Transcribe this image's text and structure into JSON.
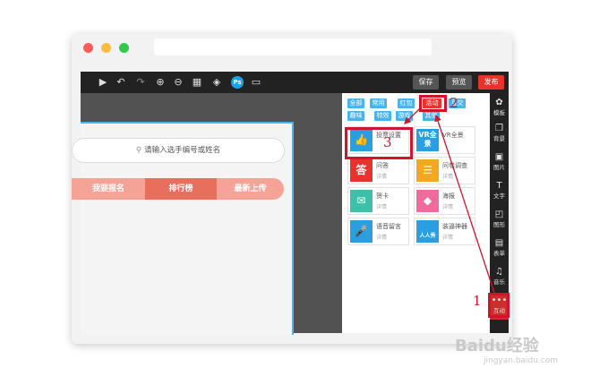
{
  "toolbar": {
    "icons": [
      "play-icon",
      "undo-icon",
      "redo-icon",
      "zoom-in-icon",
      "zoom-out-icon",
      "grid-icon",
      "layers-icon",
      "ps-icon",
      "device-icon"
    ],
    "save_label": "保存",
    "preview_label": "预览",
    "publish_label": "发布"
  },
  "canvas": {
    "search_placeholder": "请输入选手编号或姓名",
    "tabs": [
      "我要报名",
      "排行榜",
      "最新上传"
    ],
    "active_tab": "排行榜"
  },
  "panel": {
    "categories": [
      "全部",
      "常用",
      "红包",
      "活动",
      "互交",
      "趣味",
      "特效",
      "游戏",
      "其他"
    ],
    "selected_category": "活动",
    "cards": [
      {
        "title": "投票设置",
        "detail": "",
        "icon": "thumbs-up-icon",
        "color": "#2a9fe0"
      },
      {
        "title": "VR全景",
        "detail": "",
        "icon": "vr-icon",
        "color": "#2a9fe0",
        "thumb_text": "VR全景"
      },
      {
        "title": "问答",
        "detail": "详情",
        "icon": "answer-icon",
        "color": "#e8332c",
        "thumb_text": "答"
      },
      {
        "title": "问卷调查",
        "detail": "详情",
        "icon": "survey-icon",
        "color": "#f5a623"
      },
      {
        "title": "贺卡",
        "detail": "详情",
        "icon": "card-icon",
        "color": "#3dbfa8"
      },
      {
        "title": "海报",
        "detail": "详情",
        "icon": "poster-icon",
        "color": "#f06b9d"
      },
      {
        "title": "语音留言",
        "detail": "详情",
        "icon": "mic-icon",
        "color": "#2a9fe0"
      },
      {
        "title": "装逼神器",
        "detail": "详情",
        "icon": "people-icon",
        "color": "#2a9fe0",
        "thumb_text": "人人秀"
      }
    ]
  },
  "sidebar": {
    "items": [
      {
        "label": "模板",
        "icon": "template-icon"
      },
      {
        "label": "背景",
        "icon": "background-icon"
      },
      {
        "label": "图片",
        "icon": "image-icon"
      },
      {
        "label": "文字",
        "icon": "text-icon"
      },
      {
        "label": "图形",
        "icon": "shape-icon"
      },
      {
        "label": "表单",
        "icon": "form-icon"
      },
      {
        "label": "音乐",
        "icon": "music-icon"
      },
      {
        "label": "互动",
        "icon": "more-icon"
      }
    ],
    "active": "互动"
  },
  "annotations": [
    "1",
    "2",
    "3"
  ],
  "watermark": {
    "brand": "Baidu经验",
    "url": "jingyan.baidu.com"
  },
  "colors": {
    "accent_red": "#e8332c",
    "accent_blue": "#47b4f0",
    "annotation_red": "#d0142c"
  }
}
